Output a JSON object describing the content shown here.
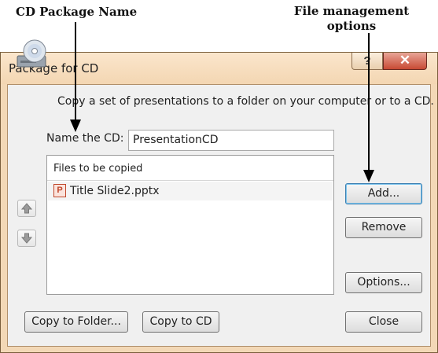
{
  "annotations": {
    "cd_package_name": "CD Package Name",
    "file_management_line1": "File management",
    "file_management_line2": "options"
  },
  "dialog": {
    "title": "Package for CD",
    "help_glyph": "?",
    "close_glyph": "✕",
    "description": "Copy a set of presentations to a folder on your computer or to a CD.",
    "name_label": "Name the CD:",
    "name_value": "PresentationCD",
    "files_header": "Files to be copied",
    "files": [
      {
        "name": "Title Slide2.pptx",
        "icon": "powerpoint-file-icon",
        "icon_glyph": "P"
      }
    ],
    "buttons": {
      "add": "Add...",
      "remove": "Remove",
      "options": "Options...",
      "copy_to_folder": "Copy to Folder...",
      "copy_to_cd": "Copy to CD",
      "close": "Close"
    },
    "icons": {
      "up": "move-up-icon",
      "down": "move-down-icon",
      "disc": "cd-drive-icon"
    }
  },
  "colors": {
    "frame": "#f3d8b6",
    "close_button": "#c84a34",
    "default_button_border": "#3c7fb1"
  }
}
